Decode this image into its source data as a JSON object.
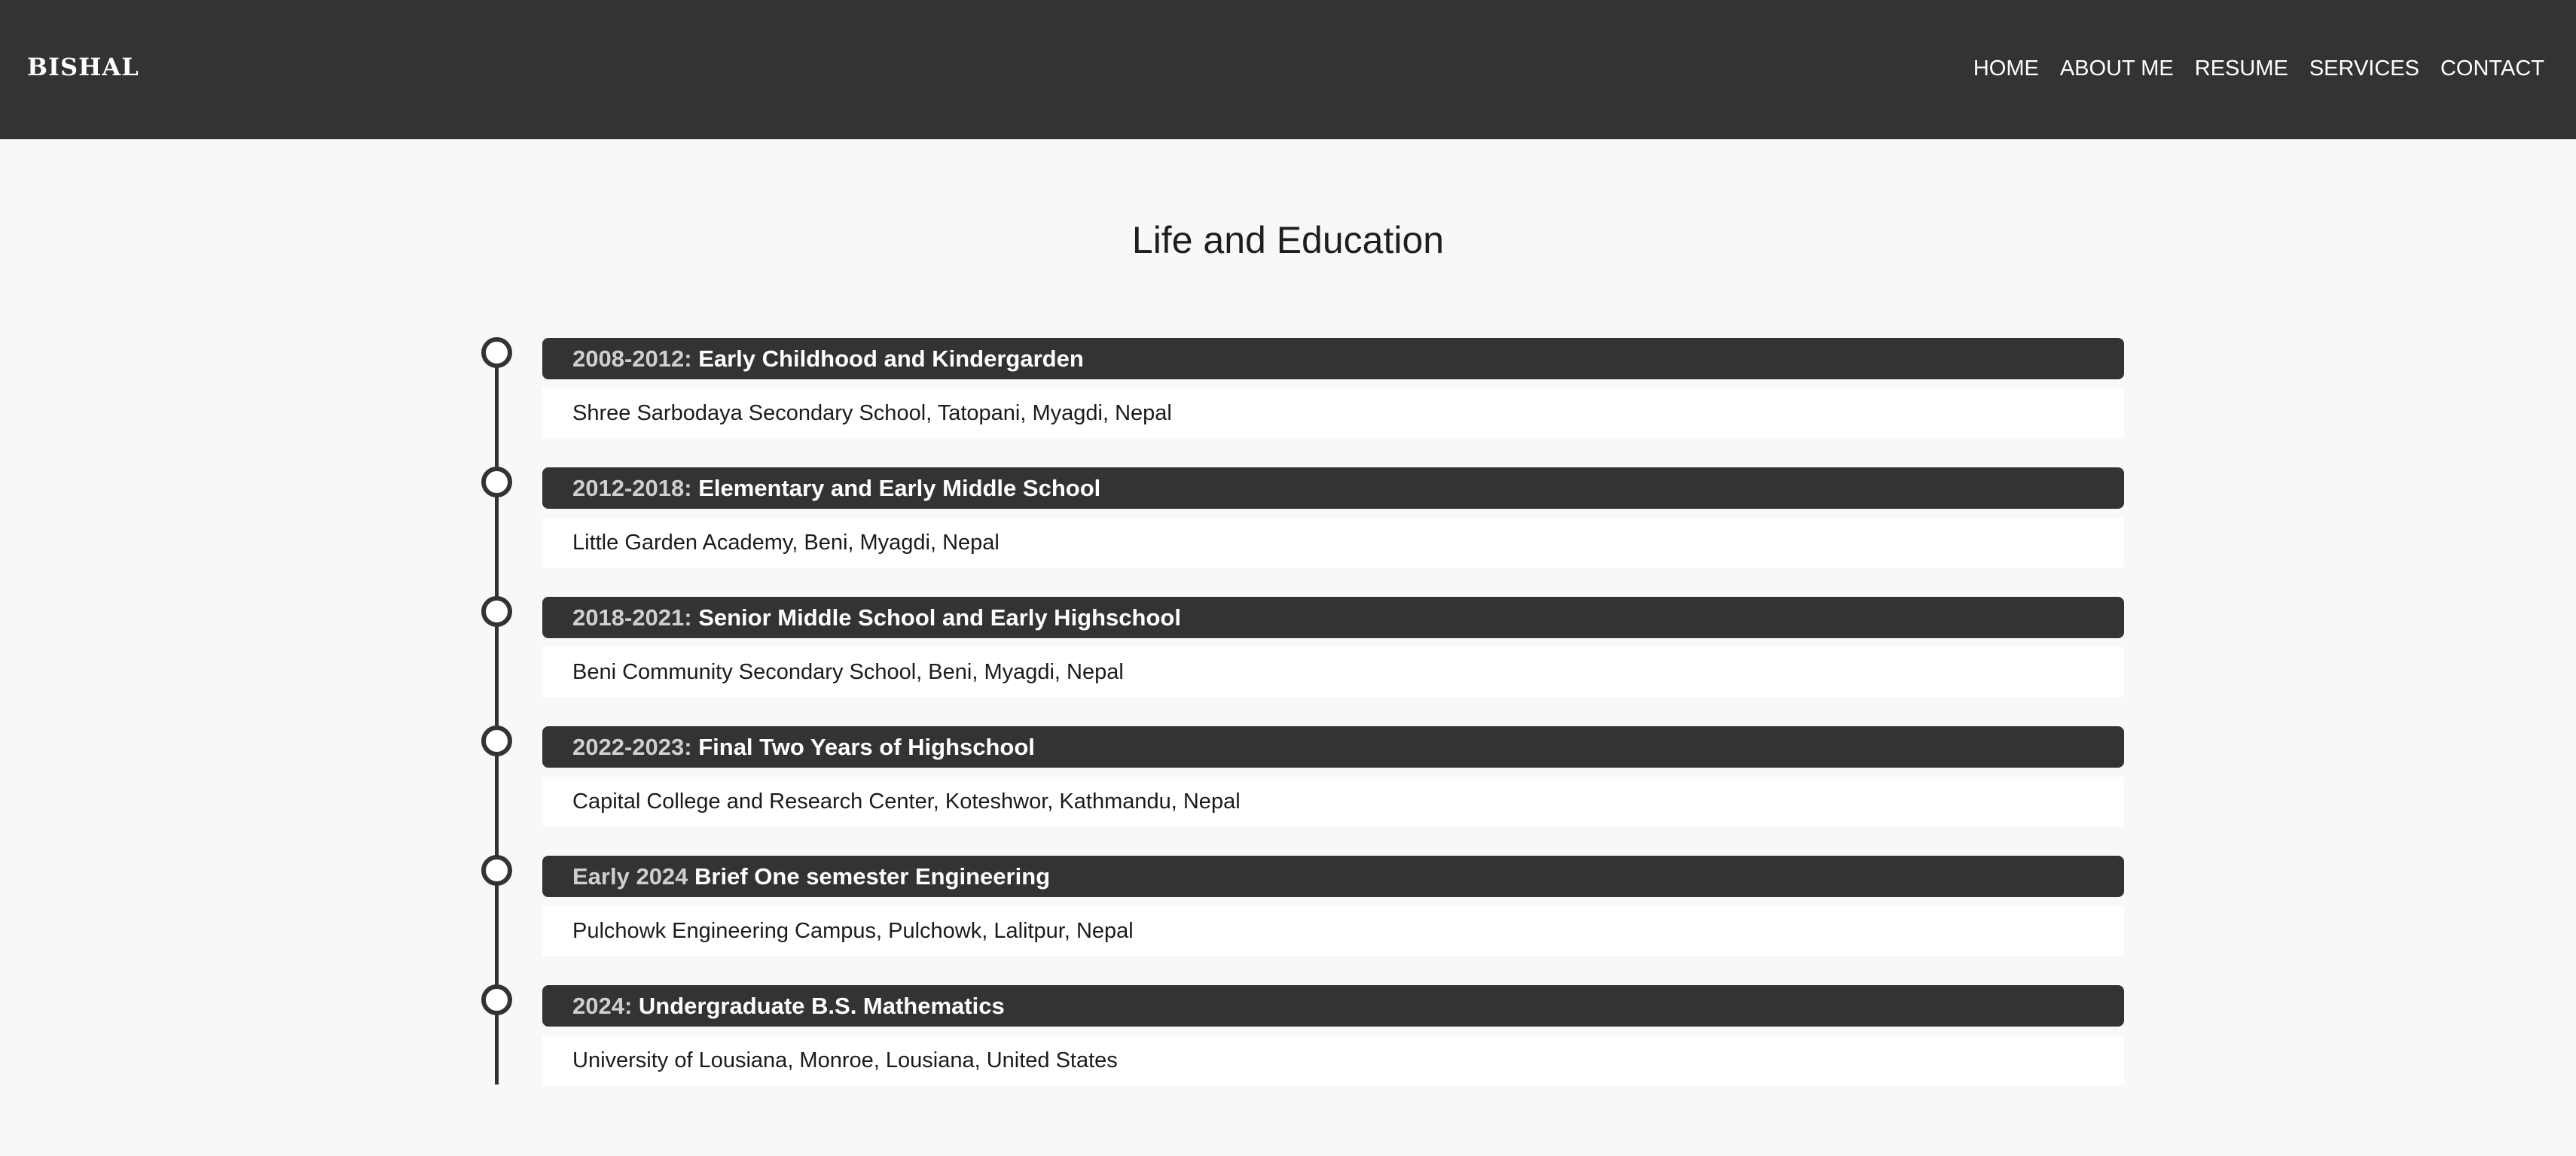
{
  "nav": {
    "brand": "BISHAL",
    "links": [
      "HOME",
      "ABOUT ME",
      "RESUME",
      "SERVICES",
      "CONTACT"
    ]
  },
  "section": {
    "title": "Life and Education"
  },
  "timeline": [
    {
      "date": "2008-2012:",
      "title": "Early Childhood and Kindergarden",
      "detail": "Shree Sarbodaya Secondary School, Tatopani, Myagdi, Nepal"
    },
    {
      "date": "2012-2018:",
      "title": "Elementary and Early Middle School",
      "detail": "Little Garden Academy, Beni, Myagdi, Nepal"
    },
    {
      "date": "2018-2021:",
      "title": "Senior Middle School and Early Highschool",
      "detail": "Beni Community Secondary School, Beni, Myagdi, Nepal"
    },
    {
      "date": "2022-2023:",
      "title": "Final Two Years of Highschool",
      "detail": "Capital College and Research Center, Koteshwor, Kathmandu, Nepal"
    },
    {
      "date": "Early 2024",
      "title": "Brief One semester Engineering",
      "detail": "Pulchowk Engineering Campus, Pulchowk, Lalitpur, Nepal"
    },
    {
      "date": "2024:",
      "title": "Undergraduate B.S. Mathematics",
      "detail": "University of Lousiana, Monroe, Lousiana, United States"
    }
  ]
}
